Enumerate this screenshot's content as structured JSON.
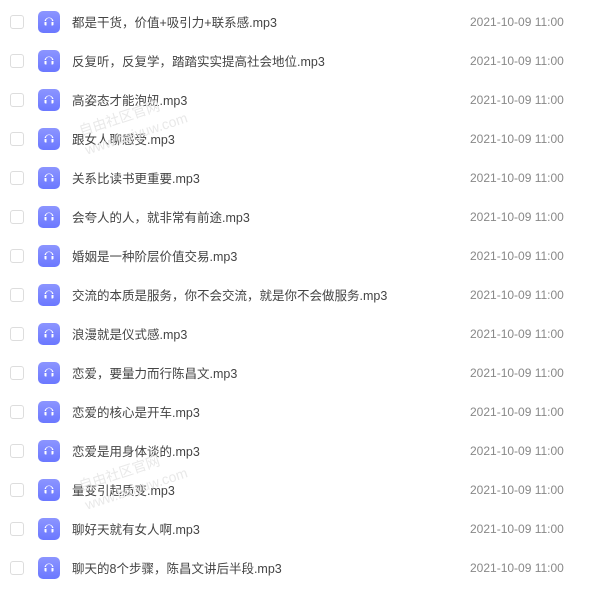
{
  "watermark": {
    "line1": "自由社区官网",
    "line2": "www.baiyuw.com"
  },
  "files": [
    {
      "name": "都是干货，价值+吸引力+联系感.mp3",
      "date": "2021-10-09 11:00"
    },
    {
      "name": "反复听，反复学，踏踏实实提高社会地位.mp3",
      "date": "2021-10-09 11:00"
    },
    {
      "name": "高姿态才能泡妞.mp3",
      "date": "2021-10-09 11:00"
    },
    {
      "name": "跟女人聊感受.mp3",
      "date": "2021-10-09 11:00"
    },
    {
      "name": "关系比读书更重要.mp3",
      "date": "2021-10-09 11:00"
    },
    {
      "name": "会夸人的人，就非常有前途.mp3",
      "date": "2021-10-09 11:00"
    },
    {
      "name": "婚姻是一种阶层价值交易.mp3",
      "date": "2021-10-09 11:00"
    },
    {
      "name": "交流的本质是服务，你不会交流，就是你不会做服务.mp3",
      "date": "2021-10-09 11:00"
    },
    {
      "name": "浪漫就是仪式感.mp3",
      "date": "2021-10-09 11:00"
    },
    {
      "name": "恋爱，要量力而行陈昌文.mp3",
      "date": "2021-10-09 11:00"
    },
    {
      "name": "恋爱的核心是开车.mp3",
      "date": "2021-10-09 11:00"
    },
    {
      "name": "恋爱是用身体谈的.mp3",
      "date": "2021-10-09 11:00"
    },
    {
      "name": "量变引起质变.mp3",
      "date": "2021-10-09 11:00"
    },
    {
      "name": "聊好天就有女人啊.mp3",
      "date": "2021-10-09 11:00"
    },
    {
      "name": "聊天的8个步骤，陈昌文讲后半段.mp3",
      "date": "2021-10-09 11:00"
    }
  ]
}
